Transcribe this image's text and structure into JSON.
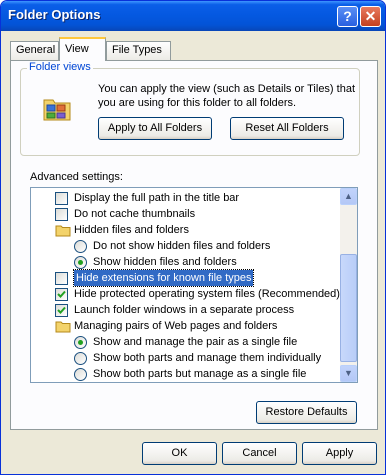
{
  "window": {
    "title": "Folder Options"
  },
  "titlebar": {
    "help_label": "?",
    "close_label": "✕"
  },
  "tabs": [
    {
      "label": "General"
    },
    {
      "label": "View"
    },
    {
      "label": "File Types"
    }
  ],
  "folder_views": {
    "label": "Folder views",
    "description": "You can apply the view (such as Details or Tiles) that you are using for this folder to all folders.",
    "apply_label": "Apply to All Folders",
    "reset_label": "Reset All Folders"
  },
  "advanced": {
    "label": "Advanced settings:",
    "items": [
      {
        "type": "checkbox",
        "checked": false,
        "label": "Display the full path in the title bar"
      },
      {
        "type": "checkbox",
        "checked": false,
        "label": "Do not cache thumbnails"
      },
      {
        "type": "folder",
        "label": "Hidden files and folders"
      },
      {
        "type": "radio",
        "checked": false,
        "label": "Do not show hidden files and folders"
      },
      {
        "type": "radio",
        "checked": true,
        "label": "Show hidden files and folders"
      },
      {
        "type": "checkbox",
        "checked": false,
        "selected": true,
        "label": "Hide extensions for known file types"
      },
      {
        "type": "checkbox",
        "checked": true,
        "label": "Hide protected operating system files (Recommended)"
      },
      {
        "type": "checkbox",
        "checked": true,
        "label": "Launch folder windows in a separate process"
      },
      {
        "type": "folder",
        "label": "Managing pairs of Web pages and folders"
      },
      {
        "type": "radio",
        "checked": true,
        "label": "Show and manage the pair as a single file"
      },
      {
        "type": "radio",
        "checked": false,
        "label": "Show both parts and manage them individually"
      },
      {
        "type": "radio",
        "checked": false,
        "label": "Show both parts but manage as a single file"
      }
    ],
    "restore_label": "Restore Defaults"
  },
  "footer": {
    "ok_label": "OK",
    "cancel_label": "Cancel",
    "apply_label": "Apply"
  }
}
